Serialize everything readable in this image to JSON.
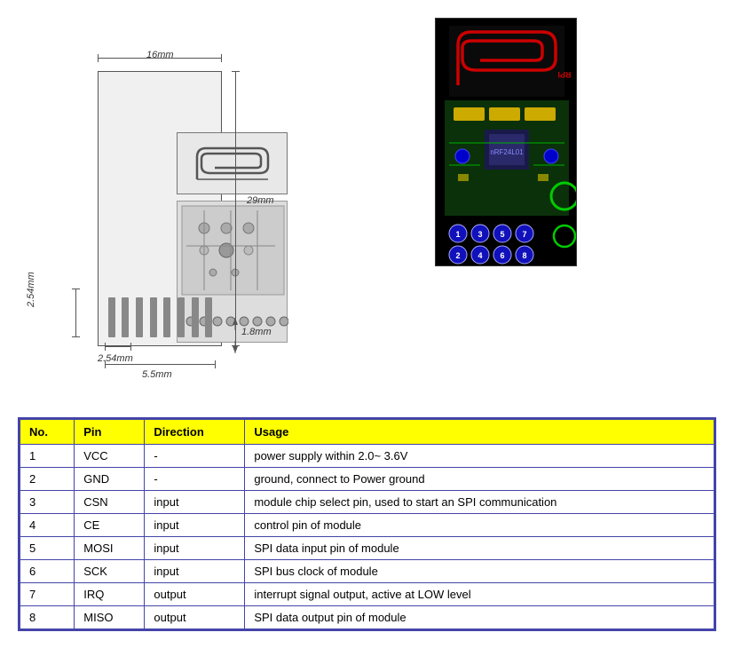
{
  "diagram": {
    "dimensions": {
      "width_label": "16mm",
      "height_label": "29mm",
      "pin_spacing_label": "2.54mm",
      "pin_spacing_h_label": "2.54mm",
      "bottom_width_label": "5.5mm",
      "side_label": "1.8mm"
    }
  },
  "table": {
    "headers": [
      "No.",
      "Pin",
      "Direction",
      "Usage"
    ],
    "rows": [
      {
        "no": "1",
        "pin": "VCC",
        "direction": "-",
        "usage": "power supply within 2.0~ 3.6V"
      },
      {
        "no": "2",
        "pin": "GND",
        "direction": "-",
        "usage": "ground, connect to Power ground"
      },
      {
        "no": "3",
        "pin": "CSN",
        "direction": "input",
        "usage": "module chip select pin, used to start an SPI communication"
      },
      {
        "no": "4",
        "pin": "CE",
        "direction": "input",
        "usage": "control pin of module"
      },
      {
        "no": "5",
        "pin": "MOSI",
        "direction": "input",
        "usage": "SPI data input pin of module"
      },
      {
        "no": "6",
        "pin": "SCK",
        "direction": "input",
        "usage": "SPI bus clock of module"
      },
      {
        "no": "7",
        "pin": "IRQ",
        "direction": "output",
        "usage": "interrupt signal output, active at LOW level"
      },
      {
        "no": "8",
        "pin": "MISO",
        "direction": "output",
        "usage": "SPI data output pin of module"
      }
    ]
  },
  "pcb_pins": [
    "1",
    "2",
    "3",
    "4",
    "5",
    "6",
    "7",
    "8"
  ]
}
